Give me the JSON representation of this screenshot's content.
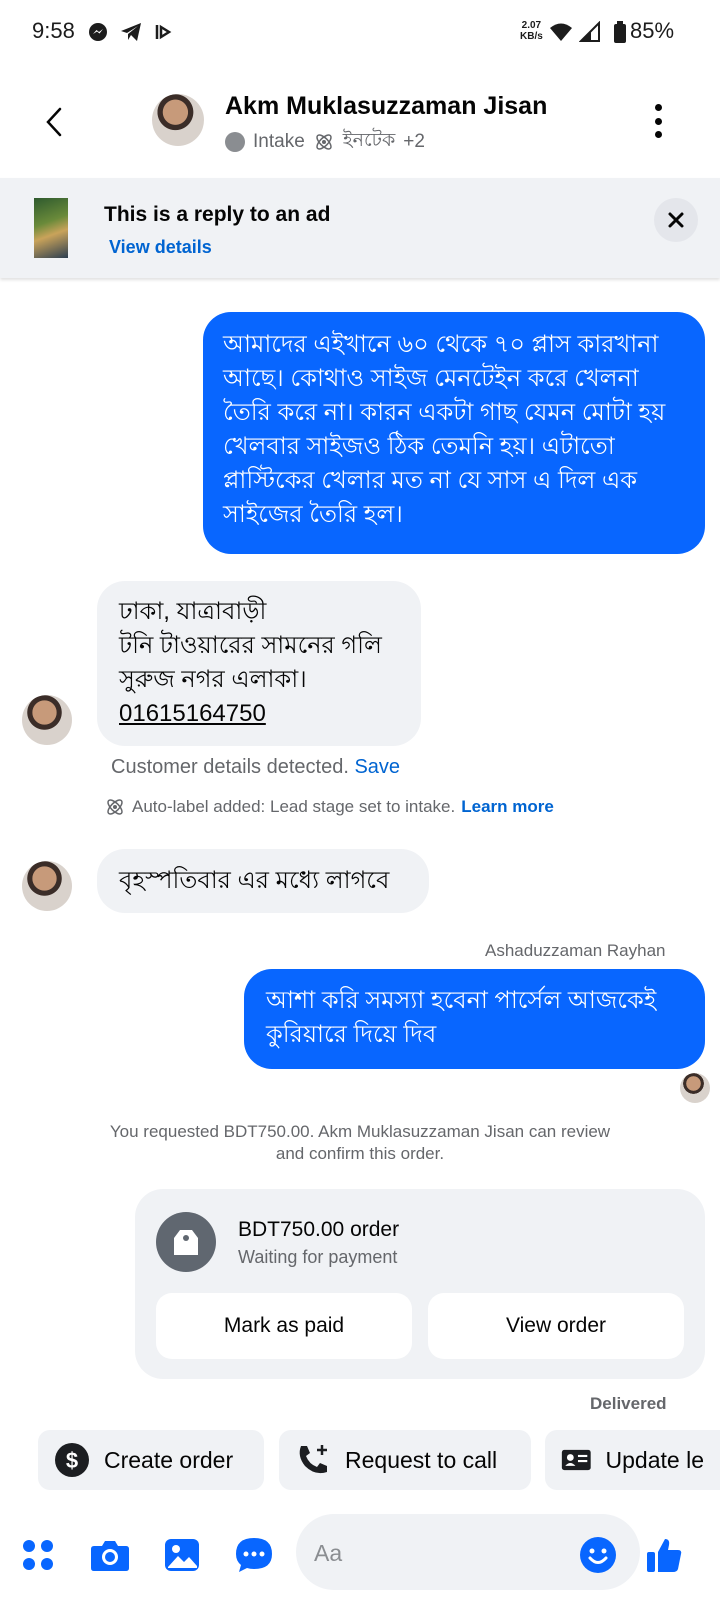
{
  "status_bar": {
    "time": "9:58",
    "speed_value": "2.07",
    "speed_unit": "KB/s",
    "battery": "85%",
    "icons": [
      "messenger-icon",
      "telegram-icon",
      "cast-icon",
      "wifi-icon",
      "signal-icon",
      "battery-icon"
    ]
  },
  "header": {
    "name": "Akm Muklasuzzaman Jisan",
    "stage": "Intake",
    "label": "ইনটেক",
    "more_labels": "+2"
  },
  "ad_banner": {
    "title": "This is a reply to an ad",
    "link": "View details"
  },
  "messages": {
    "outgoing_1": "আমাদের এইখানে ৬০ থেকে ৭০ প্লাস কারখানা আছে। কোথাও সাইজ মেনটেইন করে খেলনা তৈরি করে না। কারন একটা গাছ যেমন মোটা হয় খেলবার সাইজও ঠিক তেমনি হয়। এটাতো প্লাস্টিকের খেলার মত না যে সাস এ দিল এক সাইজের তৈরি হল।",
    "incoming_1_line1": "ঢাকা, যাত্রাবাড়ী",
    "incoming_1_line2": "টনি টাওয়ারের সামনের গলি",
    "incoming_1_line3": "সুরুজ নগর এলাকা।",
    "incoming_1_phone": "01615164750",
    "customer_detected": "Customer details detected.",
    "customer_save": "Save",
    "auto_label": "Auto-label added: Lead stage set to intake.",
    "auto_label_link": "Learn more",
    "incoming_2": "বৃহস্পতিবার এর মধ্যে লাগবে",
    "sender_name": "Ashaduzzaman Rayhan",
    "outgoing_2": "আশা করি সমস্যা হবেনা পার্সেল আজকেই কুরিয়ারে দিয়ে দিব",
    "system_note": "You requested BDT750.00. Akm Muklasuzzaman Jisan can review and confirm this order."
  },
  "order": {
    "title": "BDT750.00 order",
    "status": "Waiting for payment",
    "mark_paid": "Mark as paid",
    "view_order": "View order"
  },
  "delivered": "Delivered",
  "quick_actions": {
    "create_order": "Create order",
    "request_call": "Request to call",
    "update_lead": "Update le"
  },
  "composer": {
    "placeholder": "Aa"
  },
  "colors": {
    "accent": "#0866ff",
    "link": "#0064d1",
    "bubble_in": "#f0f2f5"
  }
}
